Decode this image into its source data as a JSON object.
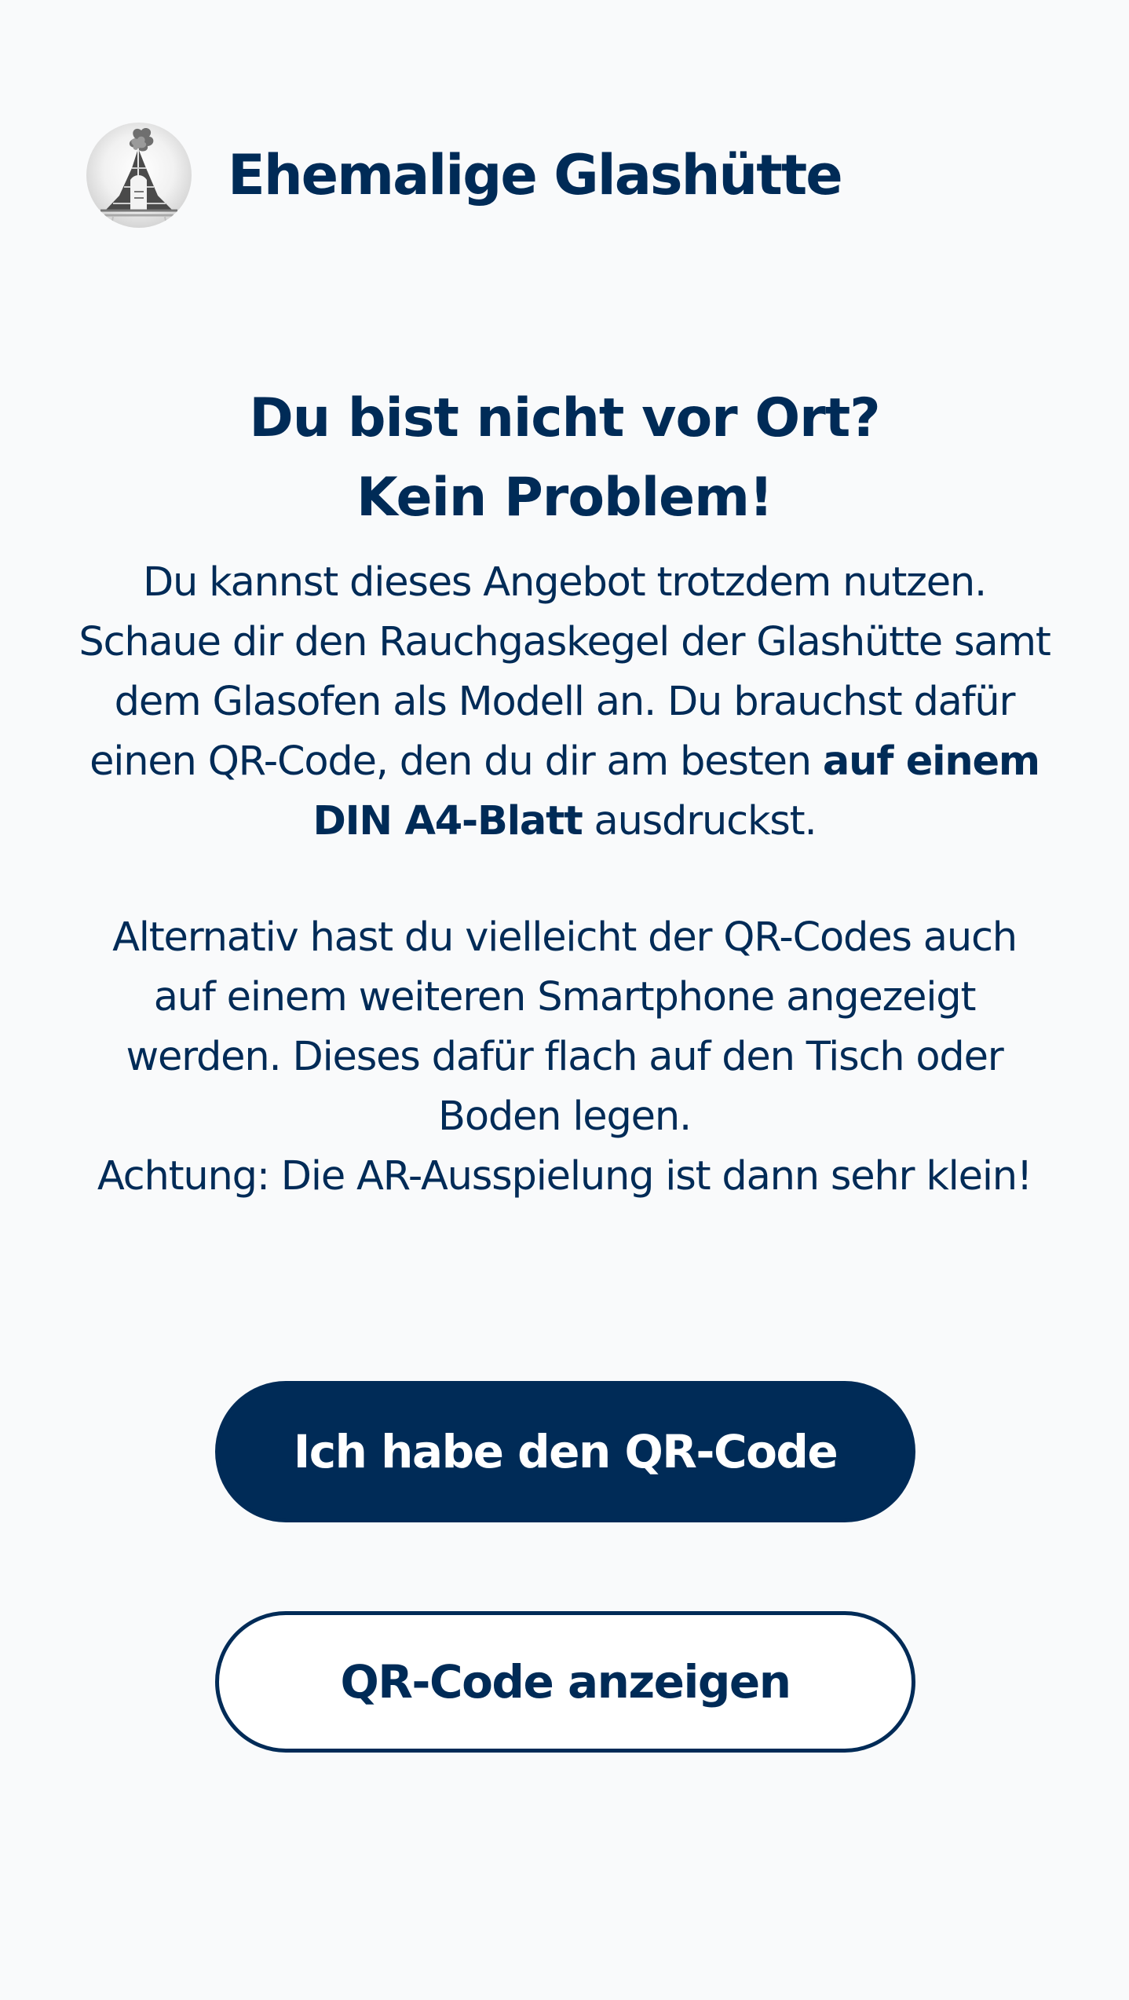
{
  "header": {
    "title": "Ehemalige Glashütte",
    "avatar_icon": "glass-furnace-cone-photo"
  },
  "main": {
    "headline_line1": "Du bist nicht vor Ort?",
    "headline_line2": "Kein Problem!",
    "paragraph1": {
      "lead": "Du kannst dieses Angebot trotzdem nutzen. Schaue dir den Rauchgaskegel der Glashütte samt dem Glasofen als Modell an. Du brauchst dafür einen QR-Code, den du dir am besten ",
      "bold": "auf einem DIN A4-Blatt",
      "tail": " ausdruckst."
    },
    "paragraph2": "Alternativ hast du vielleicht der QR-Codes auch auf einem weiteren Smartphone angezeigt werden. Dieses dafür flach auf den Tisch oder Boden legen.",
    "paragraph3": "Achtung: Die AR-Ausspielung ist dann sehr klein!"
  },
  "buttons": {
    "have_qr": "Ich habe den QR-Code",
    "show_qr": "QR-Code anzeigen"
  },
  "colors": {
    "primary": "#002b57",
    "background": "#f9fafb",
    "button_text": "#ffffff"
  }
}
